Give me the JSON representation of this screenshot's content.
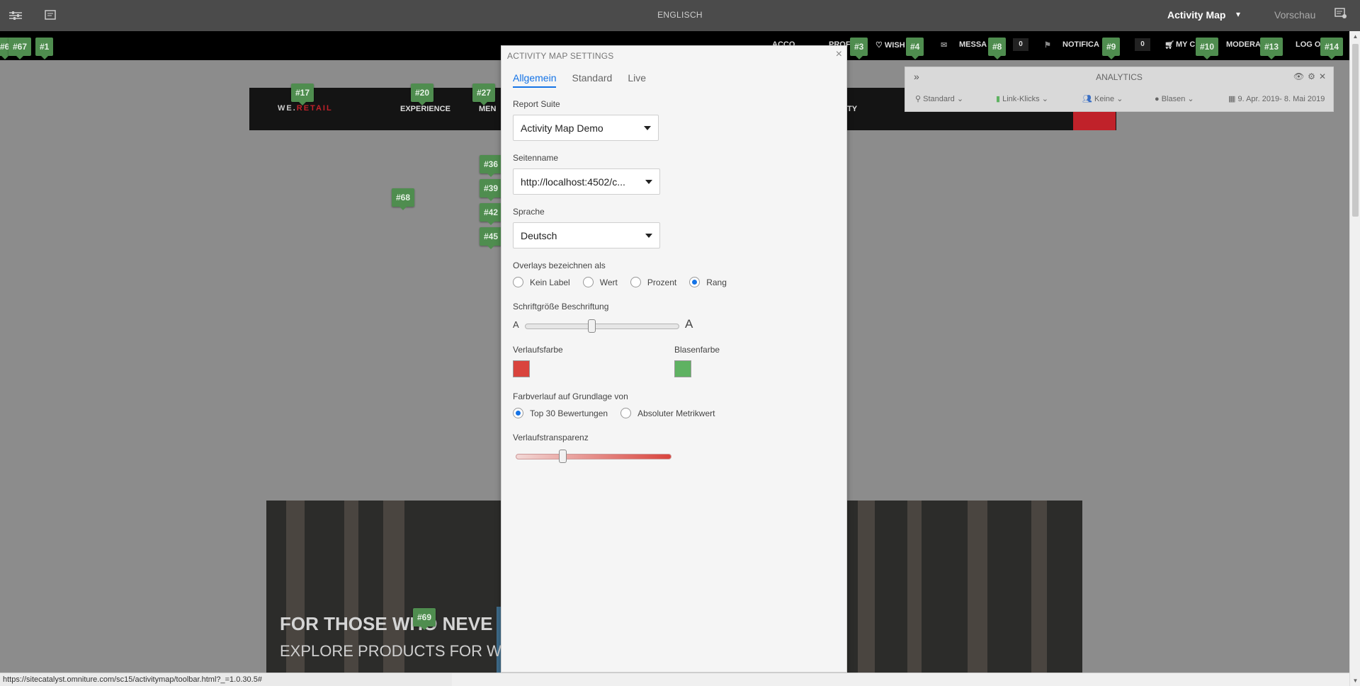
{
  "editor_bar": {
    "language": "ENGLISCH",
    "mode": "Activity Map",
    "preview": "Vorschau",
    "icons": [
      "sliders-icon",
      "page-properties-icon",
      "annotation-list-icon"
    ]
  },
  "site_strip": {
    "items": [
      "ACCO",
      "PROF",
      "♡ WISH",
      "MESSA",
      "NOTIFICA",
      "MY C",
      "MODERA",
      "LOG O"
    ],
    "counts": [
      "0",
      "0"
    ]
  },
  "site_nav": {
    "logo_prefix": "WE.",
    "logo_suffix": "RETAIL",
    "links": [
      "EXPERIENCE",
      "MEN",
      "ITY"
    ]
  },
  "hero": {
    "headline": "FOR THOSE WHO NEVE",
    "subline": "EXPLORE PRODUCTS FOR W"
  },
  "badges": [
    "#6",
    "#67",
    "#1",
    "#3",
    "#4",
    "#8",
    "#9",
    "#10",
    "#13",
    "#14",
    "#17",
    "#20",
    "#27",
    "#36",
    "#39",
    "#42",
    "#45",
    "#68",
    "#69"
  ],
  "analytics": {
    "title": "ANALYTICS",
    "items": [
      "Standard",
      "Link-Klicks",
      "Keine",
      "Blasen",
      "9. Apr. 2019- 8. Mai 2019"
    ]
  },
  "dialog": {
    "title": "ACTIVITY MAP SETTINGS",
    "tabs": [
      "Allgemein",
      "Standard",
      "Live"
    ],
    "report_suite": {
      "label": "Report Suite",
      "value": "Activity Map Demo"
    },
    "page_name": {
      "label": "Seitenname",
      "value": "http://localhost:4502/c..."
    },
    "language": {
      "label": "Sprache",
      "value": "Deutsch"
    },
    "overlay_label": {
      "label": "Overlays bezeichnen als",
      "options": [
        "Kein Label",
        "Wert",
        "Prozent",
        "Rang"
      ],
      "selected": "Rang"
    },
    "font_size": {
      "label": "Schriftgröße Beschriftung",
      "min_glyph": "A",
      "max_glyph": "A",
      "level": 0.43
    },
    "gradient_color": {
      "label": "Verlaufsfarbe",
      "color": "#d9443d"
    },
    "bubble_color": {
      "label": "Blasenfarbe",
      "color": "#5fb262"
    },
    "gradient_basis": {
      "label": "Farbverlauf auf Grundlage von",
      "options": [
        "Top 30 Bewertungen",
        "Absoluter Metrikwert"
      ],
      "selected": "Top 30 Bewertungen"
    },
    "transparency": {
      "label": "Verlaufstransparenz",
      "level": 0.3
    }
  },
  "status_url": "https://sitecatalyst.omniture.com/sc15/activitymap/toolbar.html?_=1.0.30.5#"
}
